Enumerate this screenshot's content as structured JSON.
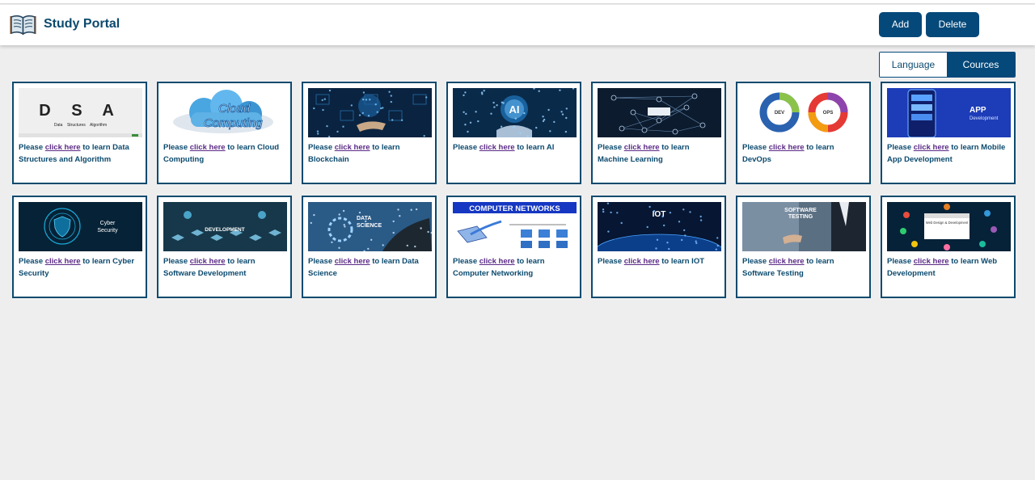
{
  "header": {
    "title": "Study Portal",
    "logo_icon": "open-book-icon",
    "add_label": "Add",
    "delete_label": "Delete"
  },
  "tabs": [
    {
      "label": "Language",
      "active": false
    },
    {
      "label": "Cources",
      "active": true
    }
  ],
  "colors": {
    "primary": "#05497a",
    "text": "#0b4a6e",
    "link": "#5b2a86",
    "background": "#efeeef"
  },
  "courses": [
    {
      "prefix": "Please ",
      "link": "click here",
      "suffix": " to learn Data Structures and Algorithm",
      "thumb": {
        "kind": "dsa",
        "letters": "D S A",
        "caption": "Data    Structures    Algorithm"
      }
    },
    {
      "prefix": "Please ",
      "link": "click here",
      "suffix": " to learn Cloud Computing",
      "thumb": {
        "kind": "cloud",
        "text1": "Cloud",
        "text2": "Computing"
      }
    },
    {
      "prefix": "Please ",
      "link": "click here",
      "suffix": " to learn Blockchain",
      "thumb": {
        "kind": "blockchain"
      }
    },
    {
      "prefix": "Please ",
      "link": "click here",
      "suffix": " to learn AI",
      "thumb": {
        "kind": "ai",
        "text": "AI"
      }
    },
    {
      "prefix": "Please ",
      "link": "click here",
      "suffix": " to learn Machine Learning",
      "thumb": {
        "kind": "ml"
      }
    },
    {
      "prefix": "Please ",
      "link": "click here",
      "suffix": " to learn DevOps",
      "thumb": {
        "kind": "devops",
        "text1": "DEV",
        "text2": "OPS"
      }
    },
    {
      "prefix": "Please ",
      "link": "click here",
      "suffix": " to learn Mobile App Development",
      "thumb": {
        "kind": "app",
        "text1": "APP",
        "text2": "Development"
      }
    },
    {
      "prefix": "Please ",
      "link": "click here",
      "suffix": " to learn Cyber Security",
      "thumb": {
        "kind": "cyber",
        "text1": "Cyber",
        "text2": "Security"
      }
    },
    {
      "prefix": "Please ",
      "link": "click here",
      "suffix": " to learn Software Development",
      "thumb": {
        "kind": "softdev",
        "text": "DEVELOPMENT"
      }
    },
    {
      "prefix": "Please ",
      "link": "click here",
      "suffix": " to learn Data Science",
      "thumb": {
        "kind": "datasci",
        "text1": "DATA",
        "text2": "SCIENCE"
      }
    },
    {
      "prefix": "Please ",
      "link": "click here",
      "suffix": " to learn Computer Networking",
      "thumb": {
        "kind": "network",
        "text": "COMPUTER NETWORKS"
      }
    },
    {
      "prefix": "Please ",
      "link": "click here",
      "suffix": " to learn IOT",
      "thumb": {
        "kind": "iot",
        "text": "IOT"
      }
    },
    {
      "prefix": "Please ",
      "link": "click here",
      "suffix": " to learn Software Testing",
      "thumb": {
        "kind": "testing",
        "text1": "SOFTWARE",
        "text2": "TESTING"
      }
    },
    {
      "prefix": "Please ",
      "link": "click here",
      "suffix": " to learn Web Development",
      "thumb": {
        "kind": "web",
        "text": "Web Design & Development"
      }
    }
  ]
}
